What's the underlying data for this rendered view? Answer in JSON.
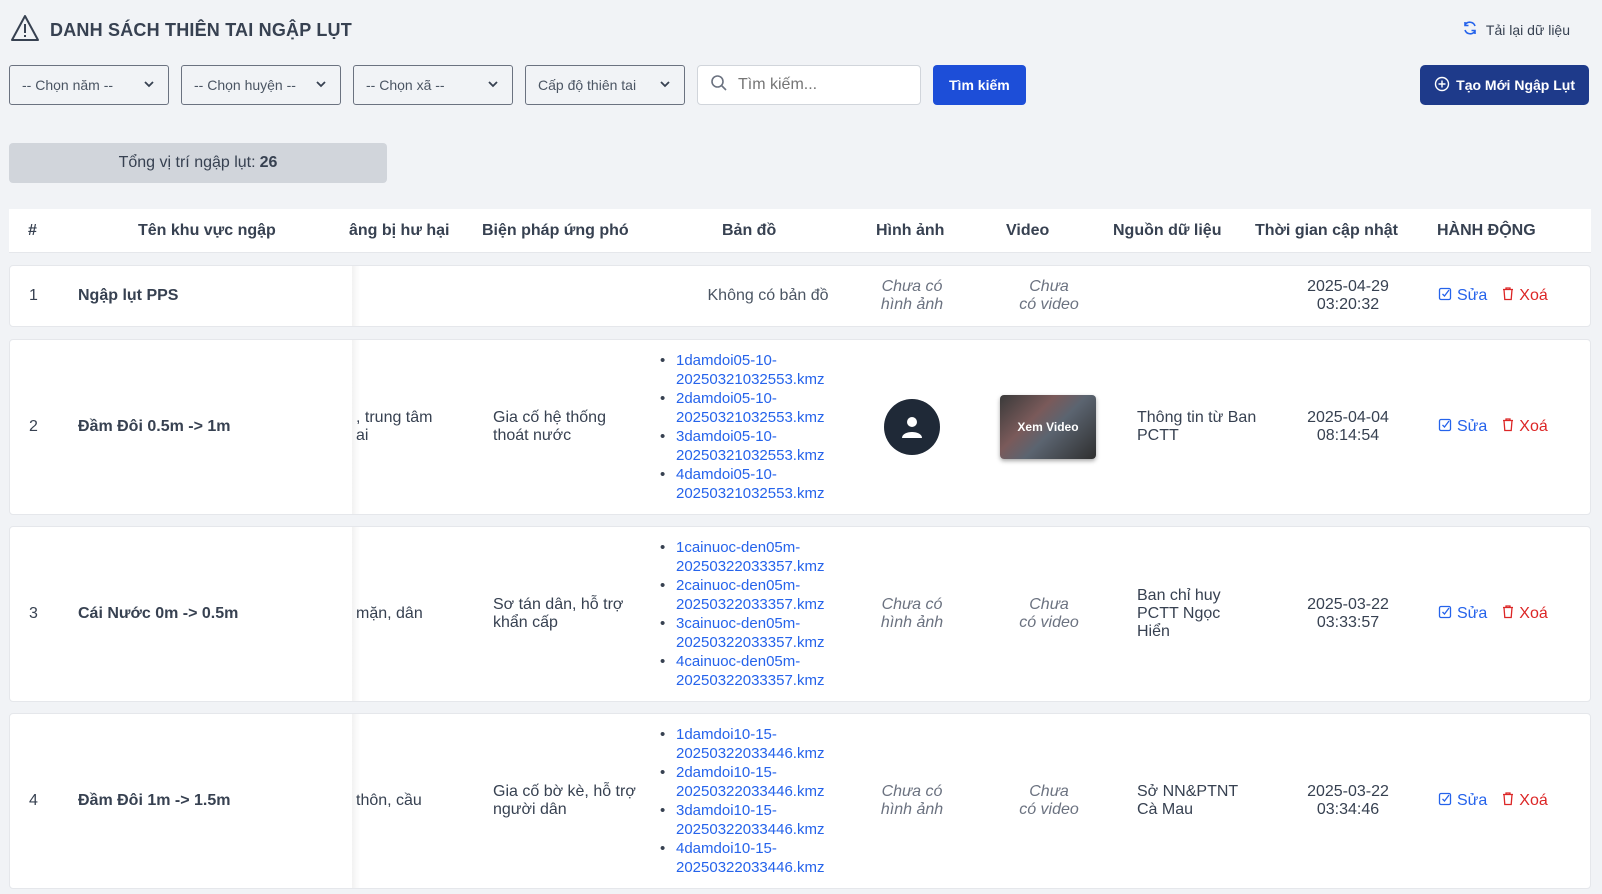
{
  "header": {
    "title": "DANH SÁCH THIÊN TAI NGẬP LỤT",
    "reload_label": "Tải lại dữ liệu"
  },
  "filters": {
    "year": "-- Chọn năm --",
    "district": "-- Chọn huyện --",
    "ward": "-- Chọn xã --",
    "level": "Cấp độ thiên tai",
    "search_placeholder": "Tìm kiếm...",
    "search_button": "Tìm kiếm"
  },
  "create_button": "Tạo Mới Ngập Lụt",
  "summary": {
    "label": "Tổng vị trí ngập lụt:",
    "count": "26"
  },
  "table": {
    "headers": {
      "idx": "#",
      "name": "Tên khu vực ngập",
      "damage": "âng bị hư hại",
      "measures": "Biện pháp ứng phó",
      "map": "Bản đồ",
      "image": "Hình ảnh",
      "video": "Video",
      "source": "Nguồn dữ liệu",
      "time": "Thời gian cập nhật",
      "actions": "HÀNH ĐỘNG"
    },
    "no_map": "Không có bản đồ",
    "no_image": "Chưa có hình ảnh",
    "no_video": "Chưa có video",
    "video_label": "Xem Video",
    "edit_label": "Sửa",
    "delete_label": "Xoá",
    "rows": [
      {
        "idx": "1",
        "name": "Ngập lụt PPS",
        "damage_1": "",
        "damage_2": "",
        "measures": "",
        "source": "",
        "date": "2025-04-29",
        "time": "03:20:32"
      },
      {
        "idx": "2",
        "name": "Đầm Đôi 0.5m -> 1m",
        "damage_1": ", trung tâm",
        "damage_2": "ai",
        "measures": "Gia cố hệ thống thoát nước",
        "maps": [
          "1damdoi05-10-20250321032553.kmz",
          "2damdoi05-10-20250321032553.kmz",
          "3damdoi05-10-20250321032553.kmz",
          "4damdoi05-10-20250321032553.kmz"
        ],
        "source": "Thông tin từ Ban PCTT",
        "date": "2025-04-04",
        "time": "08:14:54"
      },
      {
        "idx": "3",
        "name": "Cái Nước 0m -> 0.5m",
        "damage_1": "mặn, dân",
        "damage_2": "",
        "measures": "Sơ tán dân, hỗ trợ khẩn cấp",
        "maps": [
          "1cainuoc-den05m-20250322033357.kmz",
          "2cainuoc-den05m-20250322033357.kmz",
          "3cainuoc-den05m-20250322033357.kmz",
          "4cainuoc-den05m-20250322033357.kmz"
        ],
        "source": "Ban chỉ huy PCTT Ngọc Hiển",
        "date": "2025-03-22",
        "time": "03:33:57"
      },
      {
        "idx": "4",
        "name": "Đầm Đôi 1m -> 1.5m",
        "damage_1": "thôn, cầu",
        "damage_2": "",
        "measures": "Gia cố bờ kè, hỗ trợ người dân",
        "maps": [
          "1damdoi10-15-20250322033446.kmz",
          "2damdoi10-15-20250322033446.kmz",
          "3damdoi10-15-20250322033446.kmz",
          "4damdoi10-15-20250322033446.kmz"
        ],
        "source": "Sở NN&PTNT Cà Mau",
        "date": "2025-03-22",
        "time": "03:34:46"
      }
    ]
  },
  "colors": {
    "primary": "#1d4ed8",
    "navy": "#1e3a8a",
    "link": "#2563eb",
    "danger": "#dc2626",
    "background": "#f1f3f6"
  }
}
